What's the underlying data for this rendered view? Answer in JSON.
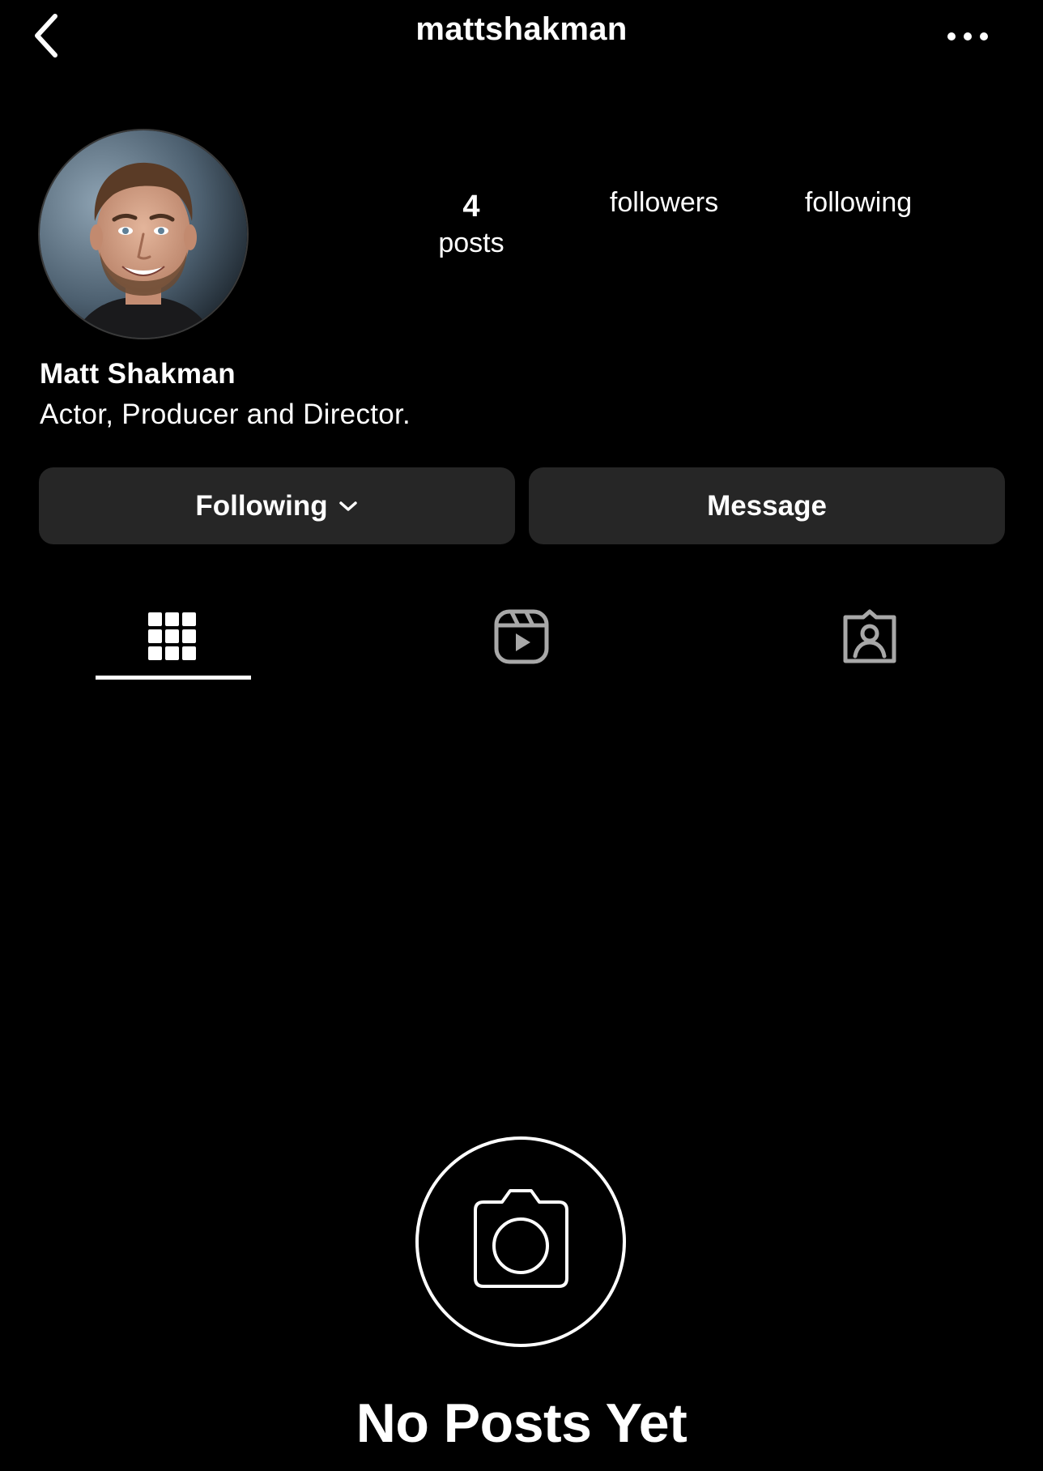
{
  "header": {
    "username": "mattshakman",
    "back_icon": "chevron-left-icon",
    "more_icon": "more-horizontal-icon"
  },
  "profile": {
    "avatar_alt": "profile photo",
    "display_name": "Matt Shakman",
    "bio": "Actor, Producer and Director."
  },
  "stats": {
    "posts_count": "4",
    "posts_label": "posts",
    "followers_label": "followers",
    "following_label": "following"
  },
  "actions": {
    "following_label": "Following",
    "message_label": "Message"
  },
  "tabs": [
    {
      "icon": "grid-icon",
      "selected": true
    },
    {
      "icon": "reels-icon",
      "selected": false
    },
    {
      "icon": "tagged-person-icon",
      "selected": false
    }
  ],
  "empty_state": {
    "icon": "camera-icon",
    "title": "No Posts Yet"
  },
  "colors": {
    "background": "#000000",
    "button_bg": "#262626",
    "text": "#ffffff",
    "inactive_icon": "#a8a8a8"
  }
}
